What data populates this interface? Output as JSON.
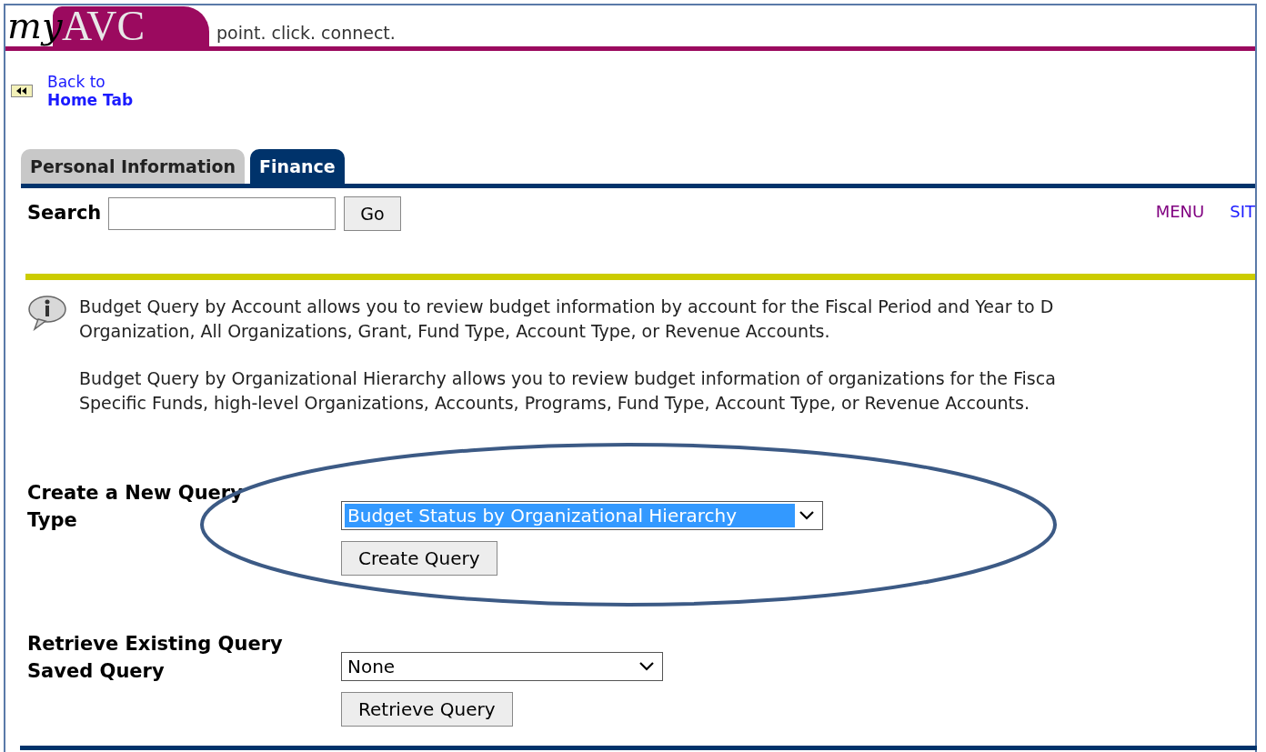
{
  "header": {
    "logo_script": "my",
    "logo_letters": "AVC",
    "tagline": "point. click. connect."
  },
  "back_link": {
    "line1": "Back to",
    "line2": "Home Tab"
  },
  "tabs": [
    {
      "label": "Personal Information",
      "selected": false
    },
    {
      "label": "Finance",
      "selected": true
    }
  ],
  "search": {
    "label": "Search",
    "button": "Go"
  },
  "nav_links": [
    {
      "label": "MENU",
      "visited": true
    },
    {
      "label": "SIT",
      "visited": false
    }
  ],
  "info": [
    {
      "lines": [
        "Budget Query by Account allows you to review budget information by account for the Fiscal Period and Year to D",
        "Organization, All Organizations, Grant, Fund Type, Account Type, or Revenue Accounts."
      ]
    },
    {
      "lines": [
        "Budget Query by Organizational Hierarchy allows you to review budget information of organizations for the Fisca",
        "Specific Funds, high-level Organizations, Accounts, Programs, Fund Type, Account Type, or Revenue Accounts."
      ]
    }
  ],
  "sections": [
    {
      "heading": "Create a New Query",
      "field_label": "Type",
      "select_value": "Budget Status by Organizational Hierarchy",
      "highlighted": true,
      "button": "Create Query",
      "annotation": {
        "kind": "ellipse"
      }
    },
    {
      "heading": "Retrieve Existing Query",
      "field_label": "Saved Query",
      "select_value": "None",
      "highlighted": false,
      "button": "Retrieve Query"
    }
  ]
}
